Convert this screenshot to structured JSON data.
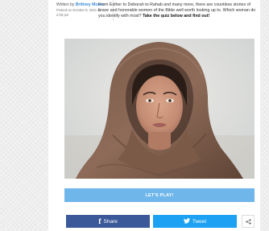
{
  "article": {
    "meta": {
      "written_by": "Written by",
      "author": "Brittney Moses",
      "posted": "Posted on October 8, 2021 at 2:00 pm"
    },
    "intro_text": "From Esther to Deborah to Rahab and many more, there are countless stories of brave and honorable women of the Bible well worth looking up to. Which woman do you identify with most?",
    "intro_cta": "Take the quiz below and find out!",
    "image": {
      "subject": "woman-in-brown-headscarf"
    },
    "play_button": "LET'S PLAY!"
  },
  "share": {
    "facebook_label": "Share",
    "twitter_label": "Tweet",
    "facebook_icon": "facebook-icon",
    "twitter_icon": "twitter-bird-icon",
    "more_icon": "share-icon"
  },
  "colors": {
    "author_link": "#3b8bd6",
    "play_button": "#6fb6ea",
    "facebook": "#3b5998",
    "twitter": "#1da1f2"
  }
}
